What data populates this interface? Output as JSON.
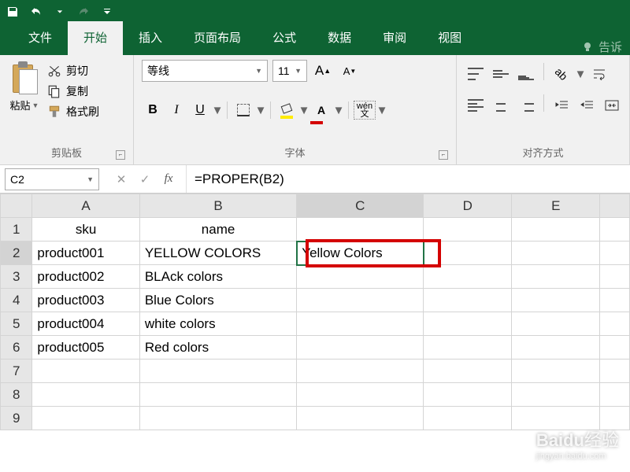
{
  "titlebar": {
    "save": "save-icon",
    "undo": "undo-icon",
    "redo": "redo-icon"
  },
  "tabs": {
    "file": "文件",
    "home": "开始",
    "insert": "插入",
    "layout": "页面布局",
    "formulas": "公式",
    "data": "数据",
    "review": "审阅",
    "view": "视图",
    "tellme": "告诉"
  },
  "ribbon": {
    "clipboard": {
      "paste": "粘贴",
      "cut": "剪切",
      "copy": "复制",
      "format_painter": "格式刷",
      "label": "剪贴板"
    },
    "font": {
      "name": "等线",
      "size": "11",
      "bold": "B",
      "italic": "I",
      "underline": "U",
      "fontcolor_letter": "A",
      "wen": "wén\n文",
      "label": "字体"
    },
    "alignment": {
      "label": "对齐方式"
    }
  },
  "formula_bar": {
    "cell_ref": "C2",
    "formula": "=PROPER(B2)"
  },
  "columns": [
    "A",
    "B",
    "C",
    "D",
    "E"
  ],
  "rows": [
    {
      "n": "1",
      "A": "sku",
      "B": "name",
      "C": "",
      "D": "",
      "E": "",
      "hdr": true
    },
    {
      "n": "2",
      "A": "product001",
      "B": "YELLOW COLORS",
      "C": "Yellow Colors",
      "D": "",
      "E": ""
    },
    {
      "n": "3",
      "A": "product002",
      "B": "BLAck colors",
      "C": "",
      "D": "",
      "E": ""
    },
    {
      "n": "4",
      "A": "product003",
      "B": "Blue Colors",
      "C": "",
      "D": "",
      "E": ""
    },
    {
      "n": "5",
      "A": "product004",
      "B": "white colors",
      "C": "",
      "D": "",
      "E": ""
    },
    {
      "n": "6",
      "A": "product005",
      "B": "Red colors",
      "C": "",
      "D": "",
      "E": ""
    },
    {
      "n": "7",
      "A": "",
      "B": "",
      "C": "",
      "D": "",
      "E": ""
    },
    {
      "n": "8",
      "A": "",
      "B": "",
      "C": "",
      "D": "",
      "E": ""
    },
    {
      "n": "9",
      "A": "",
      "B": "",
      "C": "",
      "D": "",
      "E": ""
    }
  ],
  "selected_cell": "C2",
  "watermark": {
    "brand": "Baidu",
    "sub": "经验",
    "url": "jingyan.baidu.com"
  }
}
